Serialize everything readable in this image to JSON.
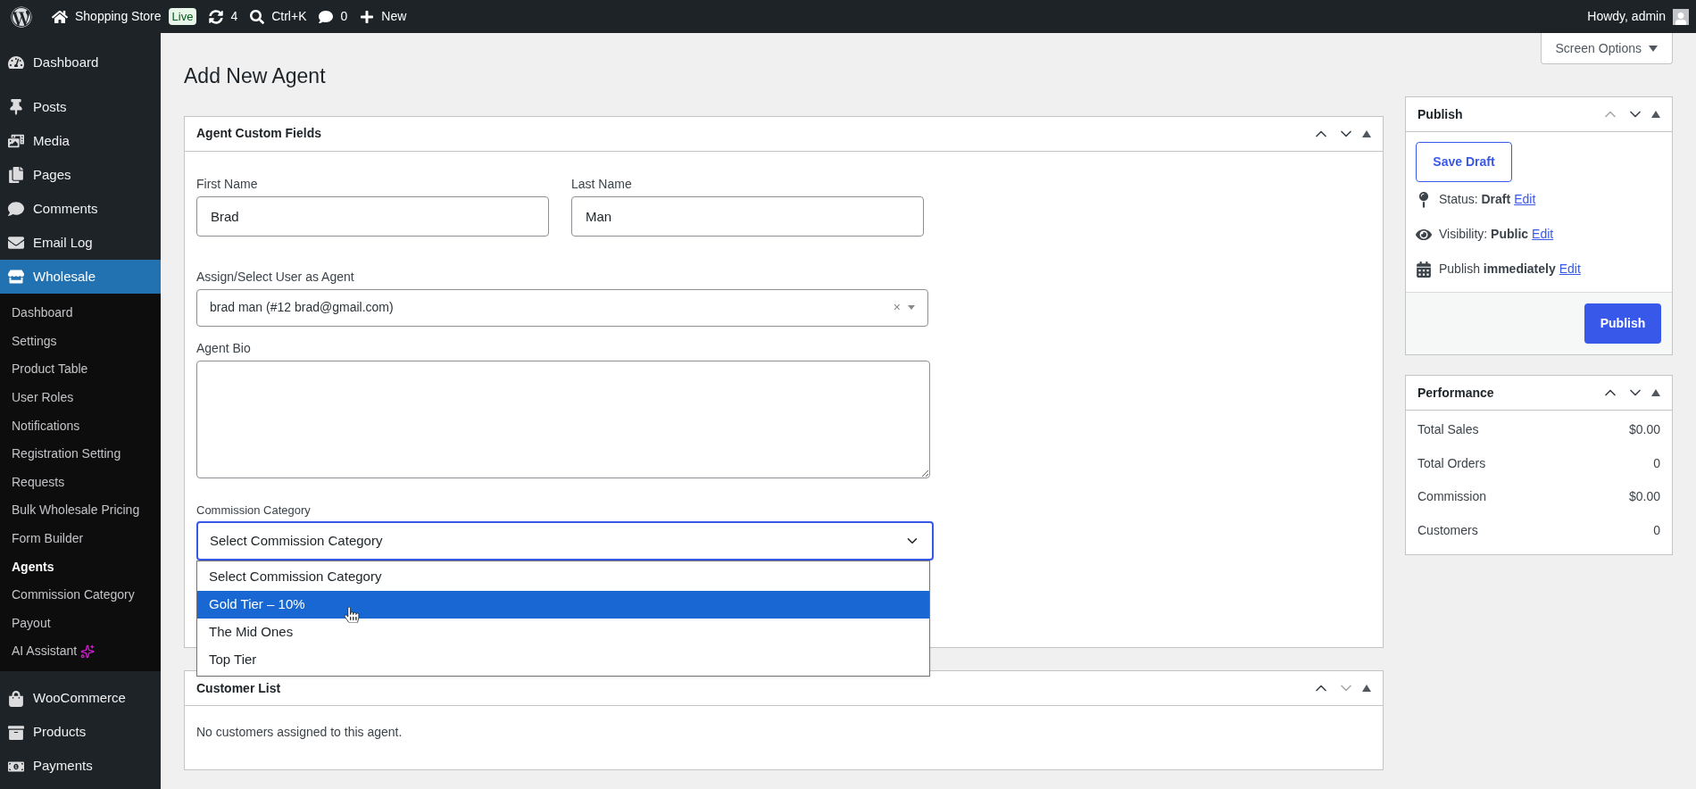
{
  "top_bar": {
    "site_name": "Shopping Store",
    "live_badge": "Live",
    "updates": "4",
    "search_shortcut": "Ctrl+K",
    "comments": "0",
    "new_label": "New",
    "greeting": "Howdy, admin"
  },
  "sidebar": {
    "items": [
      {
        "label": "Dashboard",
        "selected": false
      },
      {
        "label": "Posts",
        "selected": false
      },
      {
        "label": "Media",
        "selected": false
      },
      {
        "label": "Pages",
        "selected": false
      },
      {
        "label": "Comments",
        "selected": false
      },
      {
        "label": "Email Log",
        "selected": false
      },
      {
        "label": "Wholesale",
        "selected": true,
        "children": [
          {
            "label": "Dashboard",
            "selected": false
          },
          {
            "label": "Settings",
            "selected": false
          },
          {
            "label": "Product Table",
            "selected": false
          },
          {
            "label": "User Roles",
            "selected": false
          },
          {
            "label": "Notifications",
            "selected": false
          },
          {
            "label": "Registration Setting",
            "selected": false
          },
          {
            "label": "Requests",
            "selected": false
          },
          {
            "label": "Bulk Wholesale Pricing",
            "selected": false
          },
          {
            "label": "Form Builder",
            "selected": false
          },
          {
            "label": "Agents",
            "selected": true
          },
          {
            "label": "Commission Category",
            "selected": false
          },
          {
            "label": "Payout",
            "selected": false
          },
          {
            "label": "AI Assistant",
            "selected": false,
            "sparkle": true
          }
        ]
      },
      {
        "label": "WooCommerce",
        "selected": false
      },
      {
        "label": "Products",
        "selected": false
      },
      {
        "label": "Payments",
        "selected": false
      }
    ]
  },
  "screen_options": "Screen Options",
  "page_title": "Add New Agent",
  "agent_fields_box": {
    "title": "Agent Custom Fields",
    "can_move_up": true,
    "can_move_down": true,
    "first_name": {
      "label": "First Name",
      "value": "Brad"
    },
    "last_name": {
      "label": "Last Name",
      "value": "Man"
    },
    "user_select": {
      "label": "Assign/Select User as Agent",
      "value": "brad man (#12 brad@gmail.com)",
      "clear": "×"
    },
    "bio": {
      "label": "Agent Bio"
    },
    "commission": {
      "label": "Commission Category",
      "value": "Select Commission Category",
      "expanded": true,
      "options": [
        {
          "label": "Select Commission Category",
          "highlighted": false
        },
        {
          "label": "Gold Tier – 10%",
          "highlighted": true
        },
        {
          "label": "The Mid Ones",
          "highlighted": false
        },
        {
          "label": "Top Tier",
          "highlighted": false
        }
      ]
    }
  },
  "customer_box": {
    "title": "Customer List",
    "can_move_up": true,
    "can_move_down": false,
    "empty_text": "No customers assigned to this agent."
  },
  "publish_box": {
    "title": "Publish",
    "can_move_up": false,
    "can_move_down": true,
    "save_draft": "Save Draft",
    "rows": [
      {
        "kind": "status",
        "text": "Status: **Draft**",
        "link": "Edit"
      },
      {
        "kind": "visibility",
        "text": "Visibility: **Public**",
        "link": "Edit"
      },
      {
        "kind": "schedule",
        "text": "Publish **immediately**",
        "link": "Edit"
      }
    ],
    "publish_button": "Publish"
  },
  "performance_box": {
    "title": "Performance",
    "can_move_up": true,
    "can_move_down": true,
    "rows": [
      {
        "label": "Total Sales",
        "value": "$0.00"
      },
      {
        "label": "Total Orders",
        "value": "0"
      },
      {
        "label": "Commission",
        "value": "$0.00"
      },
      {
        "label": "Customers",
        "value": "0"
      }
    ]
  }
}
